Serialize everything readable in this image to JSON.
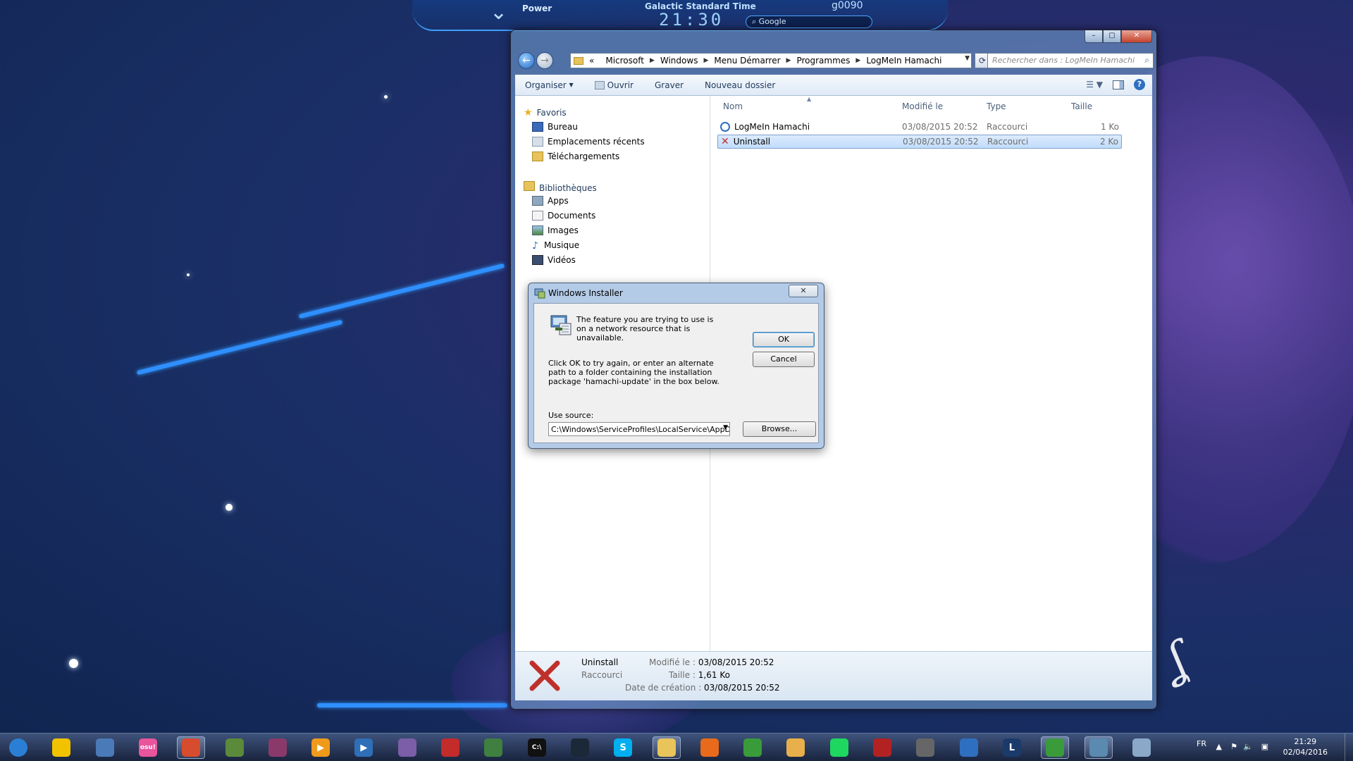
{
  "colors": {
    "accent": "#3fa0ff",
    "selection": "#c1dcfc",
    "taskbar": "#1c2745",
    "close_red": "#c4432b"
  },
  "desktop_widget": {
    "power_label": "Power",
    "clock_title": "Galactic Standard Time",
    "clock_value": "21:30",
    "search_placeholder": "Google",
    "code": "g0090"
  },
  "explorer": {
    "breadcrumb": [
      "«",
      "Microsoft",
      "Windows",
      "Menu Démarrer",
      "Programmes",
      "LogMeIn Hamachi"
    ],
    "search_placeholder": "Rechercher dans : LogMeIn Hamachi",
    "toolbar": {
      "organize": "Organiser",
      "open": "Ouvrir",
      "burn": "Graver",
      "new_folder": "Nouveau dossier"
    },
    "nav": {
      "favorites": {
        "label": "Favoris",
        "items": [
          "Bureau",
          "Emplacements récents",
          "Téléchargements"
        ]
      },
      "libraries": {
        "label": "Bibliothèques",
        "items": [
          "Apps",
          "Documents",
          "Images",
          "Musique",
          "Vidéos"
        ]
      }
    },
    "columns": {
      "name": "Nom",
      "modified": "Modifié le",
      "type": "Type",
      "size": "Taille"
    },
    "files": [
      {
        "name": "LogMeIn Hamachi",
        "modified": "03/08/2015 20:52",
        "type": "Raccourci",
        "size": "1 Ko",
        "selected": false,
        "icon": "hamachi-shortcut-icon"
      },
      {
        "name": "Uninstall",
        "modified": "03/08/2015 20:52",
        "type": "Raccourci",
        "size": "2 Ko",
        "selected": true,
        "icon": "uninstall-x-icon"
      }
    ],
    "details": {
      "name": "Uninstall",
      "type": "Raccourci",
      "modified_label": "Modifié le :",
      "modified_value": "03/08/2015 20:52",
      "size_label": "Taille :",
      "size_value": "1,61 Ko",
      "created_label": "Date de création :",
      "created_value": "03/08/2015 20:52"
    }
  },
  "dialog": {
    "title": "Windows Installer",
    "message1": "The feature you are trying to use is on a network resource that is unavailable.",
    "message2": "Click OK to try again, or enter an alternate path to a folder containing the installation package 'hamachi-update' in the box below.",
    "use_source_label": "Use source:",
    "source_value": "C:\\Windows\\ServiceProfiles\\LocalService\\AppData",
    "ok": "OK",
    "cancel": "Cancel",
    "browse": "Browse..."
  },
  "taskbar": {
    "language": "FR",
    "time": "21:29",
    "date": "02/04/2016",
    "apps": [
      {
        "name": "start-orb",
        "color": "#2a7fd4",
        "glyph": ""
      },
      {
        "name": "app-pacman",
        "color": "#f2c200",
        "glyph": ""
      },
      {
        "name": "app-script",
        "color": "#4a7ab8",
        "glyph": ""
      },
      {
        "name": "app-osu",
        "color": "#e8559c",
        "glyph": "osu!"
      },
      {
        "name": "app-snipping",
        "color": "#d74b2e",
        "glyph": ""
      },
      {
        "name": "app-minecraft",
        "color": "#5b8a3a",
        "glyph": ""
      },
      {
        "name": "app-winrar",
        "color": "#8a3a6a",
        "glyph": ""
      },
      {
        "name": "app-media-player",
        "color": "#f09a1c",
        "glyph": "▶"
      },
      {
        "name": "app-player",
        "color": "#2e6fb8",
        "glyph": "▶"
      },
      {
        "name": "app-gallery",
        "color": "#7b5ea7",
        "glyph": ""
      },
      {
        "name": "app-red",
        "color": "#c42b2b",
        "glyph": ""
      },
      {
        "name": "app-sheet",
        "color": "#3f7f3f",
        "glyph": ""
      },
      {
        "name": "app-cmd",
        "color": "#111111",
        "glyph": "C:\\"
      },
      {
        "name": "app-steam",
        "color": "#1b2838",
        "glyph": ""
      },
      {
        "name": "app-skype",
        "color": "#00aff0",
        "glyph": "S"
      },
      {
        "name": "app-explorer",
        "color": "#e9c45a",
        "glyph": ""
      },
      {
        "name": "app-orange",
        "color": "#e86a1a",
        "glyph": ""
      },
      {
        "name": "app-chrome",
        "color": "#3a9b3a",
        "glyph": ""
      },
      {
        "name": "app-naruto",
        "color": "#e8b04a",
        "glyph": ""
      },
      {
        "name": "app-spotify",
        "color": "#1ed760",
        "glyph": ""
      },
      {
        "name": "app-game",
        "color": "#b22222",
        "glyph": ""
      },
      {
        "name": "app-gamepad",
        "color": "#666666",
        "glyph": ""
      },
      {
        "name": "app-hamachi",
        "color": "#2f6fc0",
        "glyph": ""
      },
      {
        "name": "app-league",
        "color": "#1a3a6a",
        "glyph": "L"
      },
      {
        "name": "app-chrome-2",
        "color": "#3a9b3a",
        "glyph": ""
      },
      {
        "name": "app-installer",
        "color": "#5a8ab0",
        "glyph": ""
      },
      {
        "name": "app-paint",
        "color": "#8aa8c8",
        "glyph": ""
      }
    ]
  }
}
